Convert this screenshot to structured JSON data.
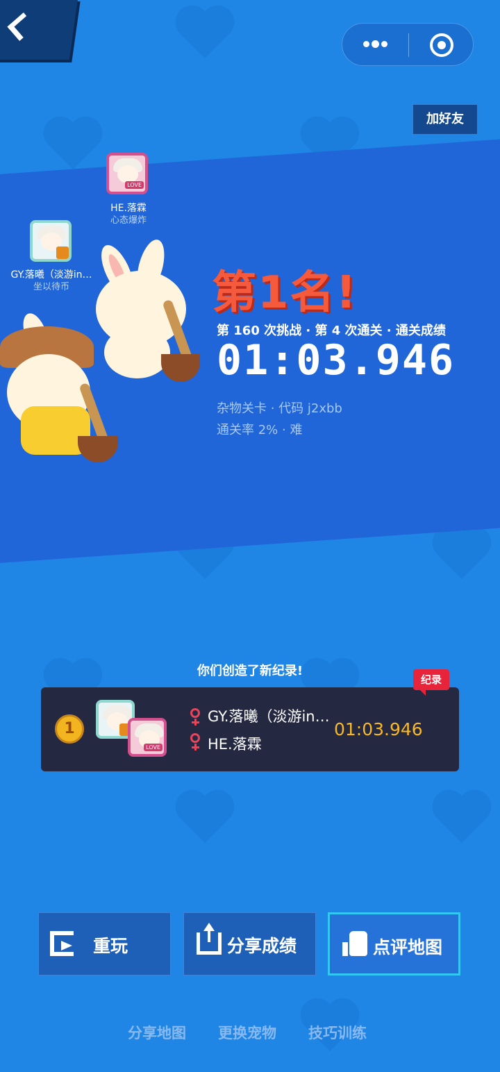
{
  "header": {
    "back_label": "‹",
    "menu_icon": "more-dots-icon",
    "target_icon": "target-icon",
    "add_friend_label": "加好友"
  },
  "players": [
    {
      "name": "HE.落霖",
      "title": "心态爆炸"
    },
    {
      "name": "GY.落曦（淡游in…",
      "title": "坐以待币"
    }
  ],
  "result": {
    "title_graphic": "第1名!",
    "info_line": "第 160 次挑战 · 第 4 次通关 · 通关成绩",
    "time": "01:03.946",
    "meta_line_1": "杂物关卡 · 代码 j2xbb",
    "meta_line_2": "通关率 2% · 难"
  },
  "record": {
    "headline": "你们创造了新纪录!",
    "tag": "纪录",
    "rank": "1",
    "names": [
      "GY.落曦（淡游in…",
      "HE.落霖"
    ],
    "time": "01:03.946"
  },
  "actions": {
    "replay": "重玩",
    "share": "分享成绩",
    "review": "点评地图"
  },
  "links": {
    "share_map": "分享地图",
    "change_pet": "更换宠物",
    "skill_training": "技巧训练"
  },
  "colors": {
    "background": "#1f86e6",
    "band": "#2166d9",
    "time_accent": "#f7b928",
    "title_red": "#f45a3b"
  }
}
